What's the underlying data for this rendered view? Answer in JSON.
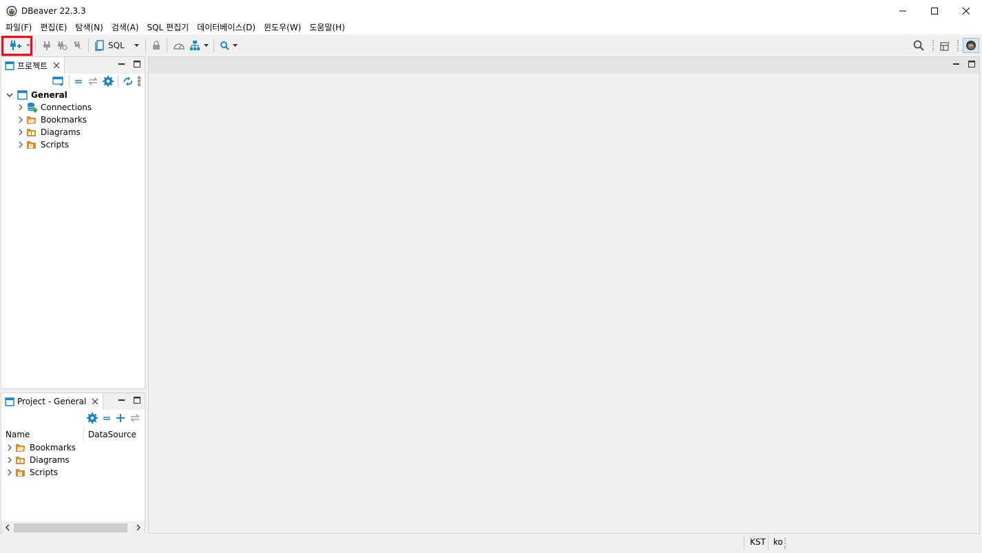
{
  "window": {
    "title": "DBeaver 22.3.3"
  },
  "menu": [
    "파일(F)",
    "편집(E)",
    "탐색(N)",
    "검색(A)",
    "SQL 편집기",
    "데이터베이스(D)",
    "윈도우(W)",
    "도움말(H)"
  ],
  "toolbar": {
    "sql_label": "SQL"
  },
  "project_panel": {
    "tab_label": "프로젝트",
    "root": "General",
    "items": [
      "Connections",
      "Bookmarks",
      "Diagrams",
      "Scripts"
    ]
  },
  "project_general_panel": {
    "tab_label": "Project - General",
    "columns": [
      "Name",
      "DataSource"
    ],
    "items": [
      "Bookmarks",
      "Diagrams",
      "Scripts"
    ]
  },
  "status": {
    "timezone": "KST",
    "locale": "ko"
  },
  "colors": {
    "highlight": "#e0121c",
    "accent_blue": "#1a86c9",
    "folder_orange": "#e8891d"
  }
}
